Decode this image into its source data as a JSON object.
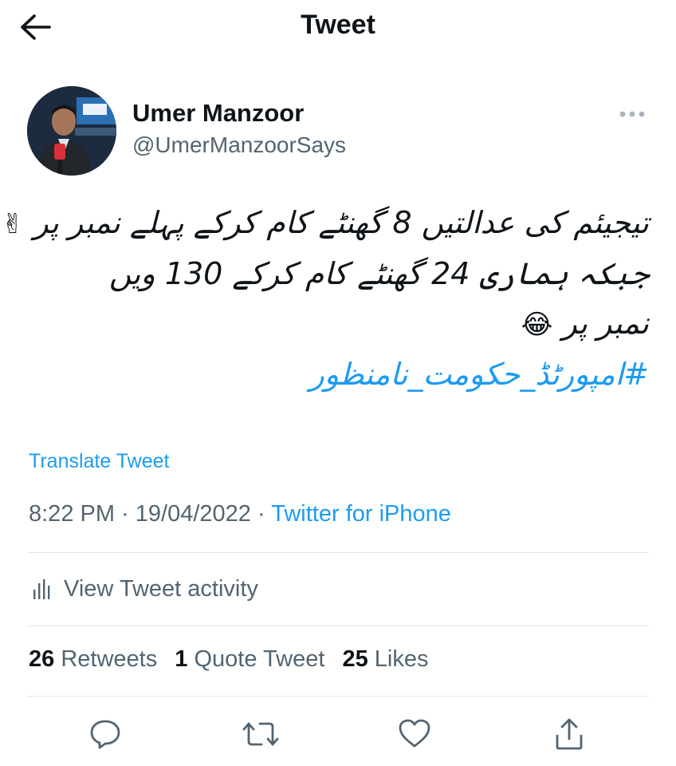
{
  "header": {
    "title": "Tweet",
    "back_icon": "arrow-left-icon"
  },
  "author": {
    "name": "Umer Manzoor",
    "handle": "@UmerManzoorSays",
    "avatar_icon": "avatar"
  },
  "tweet": {
    "lines": [
      "تیجیئم کی عدالتیں 8 گھنٹے کام کرکے پہلے نمبر پر",
      "جبکہ ہماری 24 گھنٹے کام کرکے 130 ویں",
      "نمبر پر"
    ],
    "emoji_1": "✌",
    "emoji_2": "😂",
    "hashtag": "#امپورٹڈ_حکومت_نامنظور"
  },
  "translate_label": "Translate Tweet",
  "meta": {
    "time": "8:22 PM",
    "separator": "·",
    "date": "19/04/2022",
    "source": "Twitter for iPhone"
  },
  "activity_label": "View Tweet activity",
  "stats": {
    "retweets_count": "26",
    "retweets_label": "Retweets",
    "quotes_count": "1",
    "quotes_label": "Quote Tweet",
    "likes_count": "25",
    "likes_label": "Likes"
  },
  "actions": [
    "reply-icon",
    "retweet-icon",
    "like-icon",
    "share-icon"
  ],
  "colors": {
    "accent": "#1d9bf0",
    "secondary_text": "#536471",
    "primary_text": "#0f1419",
    "divider": "#e3e6ea"
  }
}
